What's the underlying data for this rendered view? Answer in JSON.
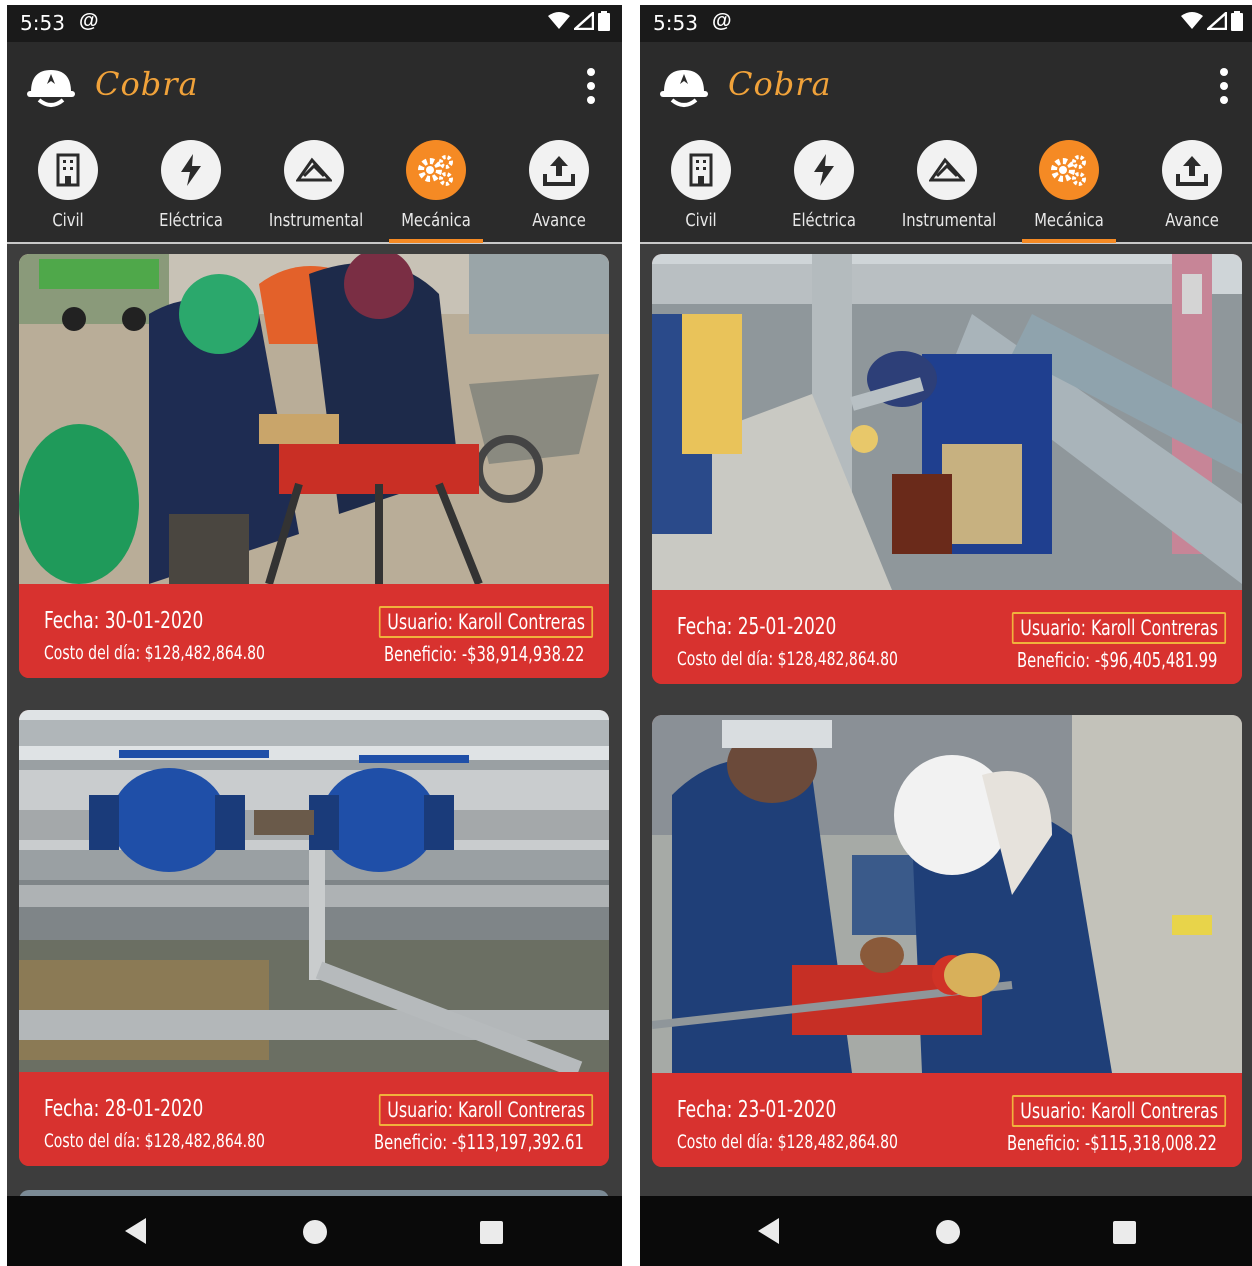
{
  "status": {
    "time": "5:53",
    "at_glyph": "@"
  },
  "app": {
    "title": "Cobra"
  },
  "tabs": [
    {
      "label": "Civil",
      "icon": "building-icon",
      "active": false
    },
    {
      "label": "Eléctrica",
      "icon": "lightning-icon",
      "active": false
    },
    {
      "label": "Instrumental",
      "icon": "instrument-icon",
      "active": false
    },
    {
      "label": "Mecánica",
      "icon": "gears-icon",
      "active": true
    },
    {
      "label": "Avance",
      "icon": "upload-icon",
      "active": false
    }
  ],
  "colors": {
    "accent": "#f58a24",
    "card": "#d8322f",
    "title": "#f0a23a",
    "border": "#f0b23c"
  },
  "left_cards": [
    {
      "fecha": "Fecha: 30-01-2020",
      "costo": "Costo del día: $128,482,864.80",
      "usuario": "Usuario: Karoll Contreras",
      "beneficio": "Beneficio: -$38,914,938.22",
      "photo": "welding-pipe-photo"
    },
    {
      "fecha": "Fecha: 28-01-2020",
      "costo": "Costo del día: $128,482,864.80",
      "usuario": "Usuario: Karoll Contreras",
      "beneficio": "Beneficio: -$113,197,392.61",
      "photo": "blue-valves-photo"
    }
  ],
  "right_cards": [
    {
      "fecha": "Fecha: 25-01-2020",
      "costo": "Costo del día: $128,482,864.80",
      "usuario": "Usuario: Karoll Contreras",
      "beneficio": "Beneficio: -$96,405,481.99",
      "photo": "welder-pipes-photo"
    },
    {
      "fecha": "Fecha: 23-01-2020",
      "costo": "Costo del día: $128,482,864.80",
      "usuario": "Usuario: Karoll Contreras",
      "beneficio": "Beneficio: -$115,318,008.22",
      "photo": "pipe-threading-photo"
    }
  ]
}
